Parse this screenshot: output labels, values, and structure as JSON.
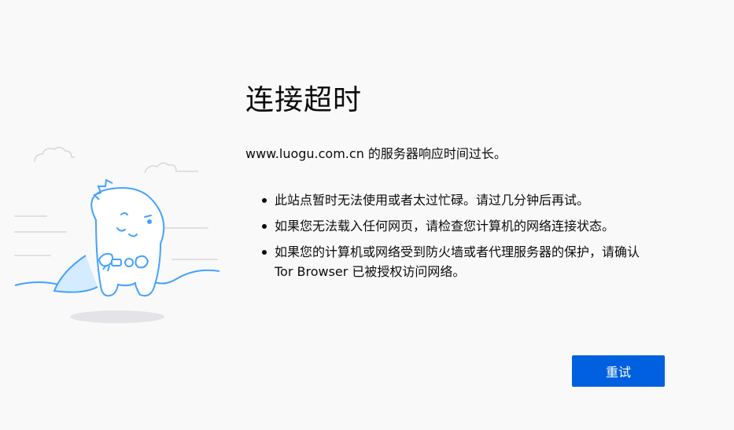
{
  "error": {
    "title": "连接超时",
    "description": "www.luogu.com.cn 的服务器响应时间过长。",
    "reasons": [
      "此站点暂时无法使用或者太过忙碌。请过几分钟后再试。",
      "如果您无法载入任何网页，请检查您计算机的网络连接状态。",
      "如果您的计算机或网络受到防火墙或者代理服务器的保护，请确认 Tor Browser 已被授权访问网络。"
    ]
  },
  "actions": {
    "retry_label": "重试"
  },
  "colors": {
    "page_background": "#f9f9fa",
    "accent": "#0060df",
    "illustration_stroke": "#45a1ff",
    "illustration_fill": "#ffffff",
    "text": "#0c0c0d"
  },
  "icons": {
    "illustration": "unplugged-dinosaur-illustration"
  }
}
